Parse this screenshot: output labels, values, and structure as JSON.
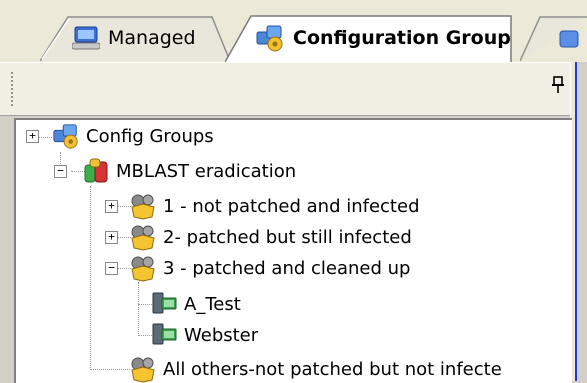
{
  "tabs": [
    {
      "label": "Managed",
      "icon": "computer-icon",
      "active": false
    },
    {
      "label": "Configuration Group",
      "icon": "config-group-icon",
      "active": true
    }
  ],
  "toolbar": {
    "pin_glyph": "ꟸ"
  },
  "tree": {
    "root": {
      "label": "Config Groups",
      "icon": "config-group-icon",
      "expanded": false
    },
    "group": {
      "label": "MBLAST eradication",
      "icon": "database-group-icon",
      "expanded": true
    },
    "items": [
      {
        "label": "1 - not patched and infected",
        "icon": "patch-shield-icon",
        "expander": "+"
      },
      {
        "label": "2- patched but still infected",
        "icon": "patch-shield-icon",
        "expander": "+"
      },
      {
        "label": "3 - patched and cleaned up",
        "icon": "patch-shield-icon",
        "expander": "−"
      },
      {
        "label": "All others-not patched but not infecte",
        "icon": "patch-shield-icon",
        "expander": ""
      }
    ],
    "machines": [
      {
        "label": "A_Test",
        "icon": "machine-icon"
      },
      {
        "label": "Webster",
        "icon": "machine-icon"
      }
    ]
  }
}
